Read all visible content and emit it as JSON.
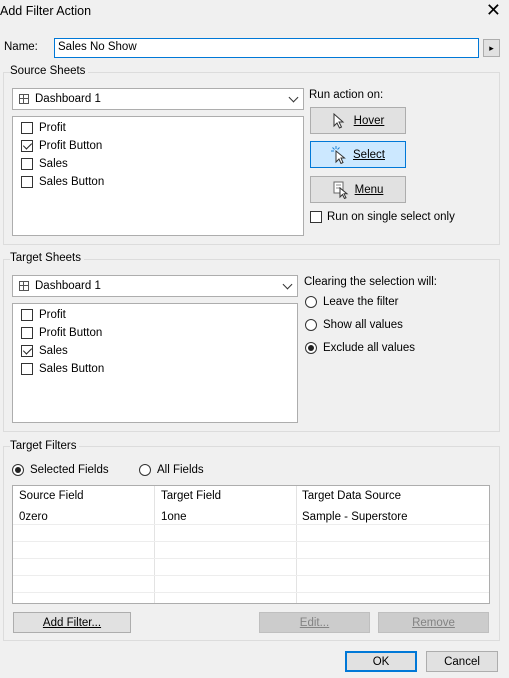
{
  "window": {
    "title": "Add Filter Action",
    "close_symbol": "✕"
  },
  "name": {
    "label": "Name:",
    "value": "Sales No Show",
    "more_symbol": "▸"
  },
  "source": {
    "group_title": "Source Sheets",
    "dashboard": "Dashboard 1",
    "sheets": [
      {
        "label": "Profit",
        "checked": false
      },
      {
        "label": "Profit Button",
        "checked": true
      },
      {
        "label": "Sales",
        "checked": false
      },
      {
        "label": "Sales Button",
        "checked": false
      }
    ],
    "run_action_label": "Run action on:",
    "hover_label": "Hover",
    "select_label": "Select",
    "menu_label": "Menu",
    "selected_trigger": "Select",
    "single_select_label": "Run on single select only",
    "single_select_checked": false
  },
  "target": {
    "group_title": "Target Sheets",
    "dashboard": "Dashboard 1",
    "sheets": [
      {
        "label": "Profit",
        "checked": false
      },
      {
        "label": "Profit Button",
        "checked": false
      },
      {
        "label": "Sales",
        "checked": true
      },
      {
        "label": "Sales Button",
        "checked": false
      }
    ],
    "clearing_label": "Clearing the selection will:",
    "options": [
      {
        "label": "Leave the filter",
        "on": false
      },
      {
        "label": "Show all values",
        "on": false
      },
      {
        "label": "Exclude all values",
        "on": true
      }
    ]
  },
  "filters": {
    "group_title": "Target Filters",
    "selected_fields_label": "Selected Fields",
    "all_fields_label": "All Fields",
    "mode": "Selected Fields",
    "columns": [
      "Source Field",
      "Target Field",
      "Target Data Source"
    ],
    "rows": [
      [
        "0zero",
        "1one",
        "Sample - Superstore"
      ]
    ],
    "add_filter_label": "Add Filter...",
    "edit_label": "Edit...",
    "remove_label": "Remove"
  },
  "footer": {
    "ok_label": "OK",
    "cancel_label": "Cancel"
  }
}
